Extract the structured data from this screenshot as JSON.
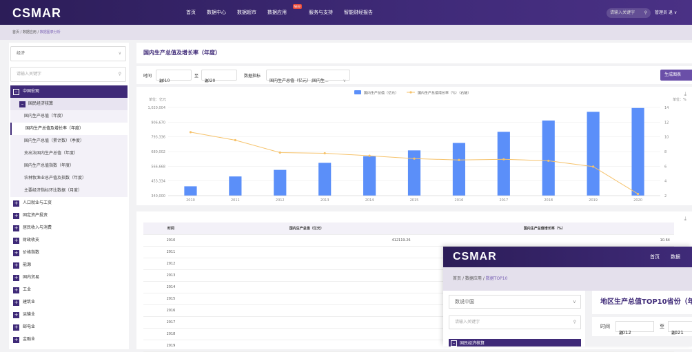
{
  "brand": "CSMAR",
  "nav": {
    "items": [
      "首页",
      "数据中心",
      "数据超市",
      "数据应用",
      "服务与支持",
      "智能财经报告"
    ],
    "active_index": 3,
    "new_badge": "NEW",
    "search_placeholder": "请输入关键字",
    "search_icon": "search-icon",
    "user": "管理员 退 ∨"
  },
  "breadcrumb": {
    "home": "首页",
    "sep": "/",
    "section": "数据应用",
    "current": "数据图表分析"
  },
  "sidebar": {
    "dropdown": "经济",
    "keyword_placeholder": "请输入关键字",
    "tree": [
      {
        "type": "top",
        "label": "中国宏观",
        "mark": "–"
      },
      {
        "type": "sub",
        "label": "国民经济核算",
        "mark": "–"
      },
      {
        "type": "leaf",
        "label": "国内生产总值（年度）"
      },
      {
        "type": "leafsel",
        "label": "国内生产总值及增长率（年度）"
      },
      {
        "type": "leaf",
        "label": "国内生产总值（累计数）（季度）"
      },
      {
        "type": "leaf",
        "label": "支出法国内生产总值（年度）"
      },
      {
        "type": "leaf",
        "label": "国内生产总值指数（年度）"
      },
      {
        "type": "leaf",
        "label": "农林牧渔业总产值及指数（年度）"
      },
      {
        "type": "leaf",
        "label": "主要经济指标环比数据（月度）"
      },
      {
        "type": "grp",
        "label": "人口就业与工资",
        "mark": "+"
      },
      {
        "type": "grp",
        "label": "固定资产投资",
        "mark": "+"
      },
      {
        "type": "grp",
        "label": "居民收入与消费",
        "mark": "+"
      },
      {
        "type": "grp",
        "label": "财政收支",
        "mark": "+"
      },
      {
        "type": "grp",
        "label": "价格指数",
        "mark": "+"
      },
      {
        "type": "grp",
        "label": "能源",
        "mark": "+"
      },
      {
        "type": "grp",
        "label": "国内贸易",
        "mark": "+"
      },
      {
        "type": "grp",
        "label": "工业",
        "mark": "+"
      },
      {
        "type": "grp",
        "label": "建筑业",
        "mark": "+"
      },
      {
        "type": "grp",
        "label": "运输业",
        "mark": "+"
      },
      {
        "type": "grp",
        "label": "邮电业",
        "mark": "+"
      },
      {
        "type": "grp",
        "label": "金融业",
        "mark": "+"
      }
    ]
  },
  "page": {
    "title": "国内生产总值及增长率（年度）",
    "filter": {
      "time_label": "时间",
      "from": "2010",
      "to_label": "至",
      "to": "2020",
      "indicator_label": "数据指标",
      "indicator_value": "国内生产总值（亿元）;国内生...",
      "calendar_icon": "calendar-icon",
      "generate": "生成图表"
    },
    "download_icon": "download-icon"
  },
  "chart_data": {
    "type": "bar",
    "categories": [
      "2010",
      "2011",
      "2012",
      "2013",
      "2014",
      "2015",
      "2016",
      "2017",
      "2018",
      "2019",
      "2020"
    ],
    "series": [
      {
        "name": "国内生产总值（亿元）",
        "type": "bar",
        "axis": "left",
        "color": "#5b8ff9",
        "values": [
          412119.26,
          487940.18,
          538580.0,
          592963.2,
          643563.1,
          688858.2,
          746395.1,
          832035.9,
          919281.1,
          986515.2,
          1015986.2
        ]
      },
      {
        "name": "国内生产总值增长率（%）（右轴）",
        "type": "line",
        "axis": "right",
        "color": "#f6c26a",
        "values": [
          10.64,
          9.55,
          7.86,
          7.77,
          7.43,
          7.04,
          6.85,
          6.95,
          6.75,
          5.95,
          2.24
        ]
      }
    ],
    "ylabel": "单位：亿元",
    "y2label": "单位：%",
    "yticks": [
      "1,020,004",
      "906,670",
      "793,336",
      "680,002",
      "566,668",
      "453,334",
      "340,000"
    ],
    "ylim": [
      340000,
      1020004
    ],
    "y2ticks": [
      "14",
      "12",
      "10",
      "8",
      "6",
      "4",
      "2"
    ],
    "y2lim": [
      2,
      14
    ],
    "legend": "top-center"
  },
  "table": {
    "headers": [
      "时间",
      "国内生产总值（亿元）",
      "国内生产总值增长率（%）"
    ],
    "rows": [
      [
        "2010",
        "412119.26",
        "10.64"
      ],
      [
        "2011",
        "",
        ""
      ],
      [
        "2012",
        "",
        ""
      ],
      [
        "2013",
        "",
        ""
      ],
      [
        "2014",
        "",
        ""
      ],
      [
        "2015",
        "",
        ""
      ],
      [
        "2016",
        "",
        ""
      ],
      [
        "2017",
        "",
        ""
      ],
      [
        "2018",
        "",
        ""
      ],
      [
        "2019",
        "",
        ""
      ]
    ]
  },
  "overlay": {
    "brand": "CSMAR",
    "nav": [
      "首页",
      "数据"
    ],
    "breadcrumb": {
      "home": "首页",
      "sep": "/",
      "section": "数据应用",
      "current": "数据TOP10"
    },
    "dropdown": "数说中国",
    "keyword_placeholder": "请输入关键字",
    "tree_top": "国民经济核算",
    "title": "地区生产总值TOP10省份（年",
    "filter": {
      "time_label": "时间",
      "from": "2012",
      "to_label": "至",
      "to": "2021"
    }
  },
  "colors": {
    "brand_dark": "#2c1d58",
    "brand": "#3f2a78",
    "accent": "#6a4fa8",
    "active_nav": "#f5a623",
    "bar": "#5b8ff9",
    "line": "#f6c26a"
  }
}
